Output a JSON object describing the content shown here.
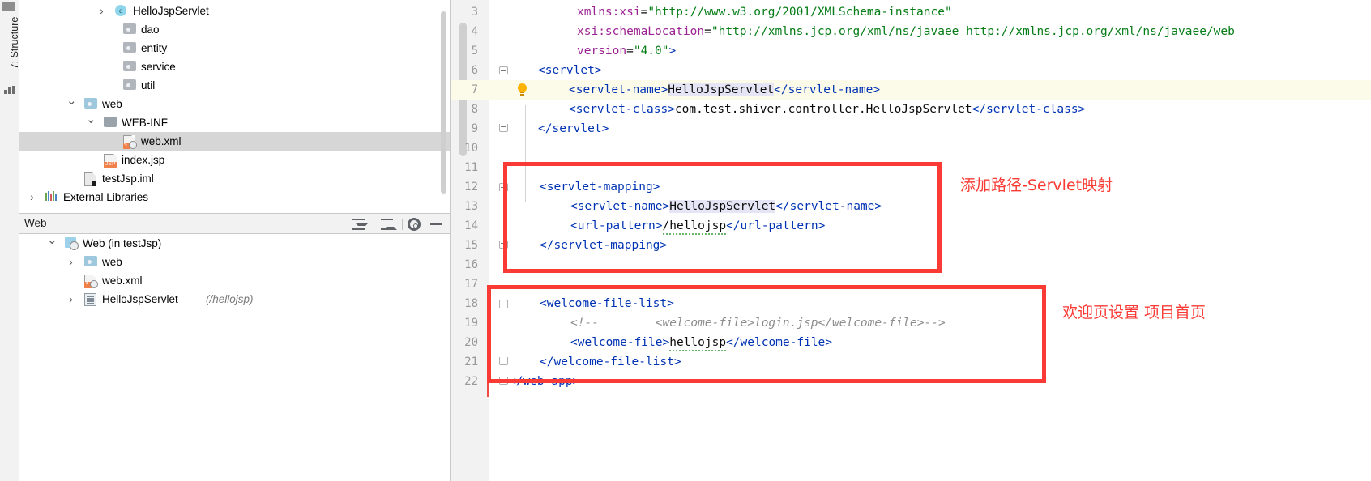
{
  "left_strip": {
    "label": "7: Structure",
    "square_icon": "panel-icon",
    "dots_icon": "structure-bars-icon"
  },
  "project_tree": {
    "items": [
      {
        "label": "HelloJspServlet",
        "icon": "class-icon",
        "arrow": "chevron-right",
        "indent": 118,
        "selected": false,
        "sub": ""
      },
      {
        "label": "dao",
        "icon": "folder-icon",
        "arrow": "",
        "indent": 128,
        "selected": false,
        "sub": ""
      },
      {
        "label": "entity",
        "icon": "folder-icon",
        "arrow": "",
        "indent": 128,
        "selected": false,
        "sub": ""
      },
      {
        "label": "service",
        "icon": "folder-icon",
        "arrow": "",
        "indent": 128,
        "selected": false,
        "sub": ""
      },
      {
        "label": "util",
        "icon": "folder-icon",
        "arrow": "",
        "indent": 128,
        "selected": false,
        "sub": ""
      },
      {
        "label": "web",
        "icon": "web-folder-icon",
        "arrow": "chevron-down",
        "indent": 80,
        "selected": false,
        "sub": ""
      },
      {
        "label": "WEB-INF",
        "icon": "folder-plain-icon",
        "arrow": "chevron-down",
        "indent": 104,
        "selected": false,
        "sub": ""
      },
      {
        "label": "web.xml",
        "icon": "xml-file-icon",
        "arrow": "",
        "indent": 128,
        "selected": true,
        "sub": ""
      },
      {
        "label": "index.jsp",
        "icon": "jsp-file-icon",
        "arrow": "",
        "indent": 104,
        "selected": false,
        "sub": ""
      },
      {
        "label": "testJsp.iml",
        "icon": "iml-file-icon",
        "arrow": "",
        "indent": 80,
        "selected": false,
        "sub": ""
      },
      {
        "label": "External Libraries",
        "icon": "libraries-icon",
        "arrow": "chevron-right",
        "indent": 32,
        "selected": false,
        "sub": ""
      }
    ]
  },
  "web_panel": {
    "title": "Web",
    "toolbar": [
      {
        "name": "expand-all-button",
        "icon": "expand-all-icon"
      },
      {
        "name": "collapse-all-button",
        "icon": "collapse-all-icon"
      },
      {
        "name": "settings-button",
        "icon": "gear-icon"
      },
      {
        "name": "hide-button",
        "icon": "minus-icon"
      }
    ],
    "items": [
      {
        "label": "Web (in testJsp)",
        "icon": "module-icon",
        "arrow": "chevron-down",
        "indent": 56,
        "sub": ""
      },
      {
        "label": "web",
        "icon": "web-folder-icon",
        "arrow": "chevron-right",
        "indent": 80,
        "sub": ""
      },
      {
        "label": "web.xml",
        "icon": "xml-file-icon",
        "arrow": "",
        "indent": 80,
        "sub": ""
      },
      {
        "label": "HelloJspServlet",
        "icon": "servlet-icon",
        "arrow": "chevron-right",
        "indent": 80,
        "sub": "(/hellojsp)"
      }
    ]
  },
  "editor": {
    "lines": [
      {
        "num": "3",
        "indent": 156,
        "html": "<span class='attr'>xmlns:xsi</span><span class='txtv'>=</span><span class='str'>\"http://www.w3.org/2001/XMLSchema-instance\"</span>",
        "highlight": false,
        "fold": "",
        "bulb": false
      },
      {
        "num": "4",
        "indent": 156,
        "html": "<span class='attr'>xsi:schemaLocation</span><span class='txtv'>=</span><span class='str'>\"http://xmlns.jcp.org/xml/ns/javaee http://xmlns.jcp.org/xml/ns/javaee/web</span>",
        "highlight": false,
        "fold": "",
        "bulb": false
      },
      {
        "num": "5",
        "indent": 156,
        "html": "<span class='attr'>version</span><span class='txtv'>=</span><span class='str'>\"4.0\"</span><span class='tag'>&gt;</span>",
        "highlight": false,
        "fold": "",
        "bulb": false
      },
      {
        "num": "6",
        "indent": 108,
        "html": "<span class='tag'>&lt;servlet&gt;</span>",
        "highlight": false,
        "fold": "top",
        "bulb": false
      },
      {
        "num": "7",
        "indent": 146,
        "html": "<span class='tag'>&lt;servlet-name&gt;</span><span class='txtv hlw'>HelloJspServlet</span><span class='tag'>&lt;/servlet-name&gt;</span>",
        "highlight": true,
        "fold": "",
        "bulb": true
      },
      {
        "num": "8",
        "indent": 146,
        "html": "<span class='tag'>&lt;servlet-class&gt;</span><span class='txtv'>com.test.shiver.controller.HelloJspServlet</span><span class='tag'>&lt;/servlet-class&gt;</span>",
        "highlight": false,
        "fold": "",
        "bulb": false
      },
      {
        "num": "9",
        "indent": 108,
        "html": "<span class='tag'>&lt;/servlet&gt;</span>",
        "highlight": false,
        "fold": "bot",
        "bulb": false
      },
      {
        "num": "10",
        "indent": 108,
        "html": "",
        "highlight": false,
        "fold": "",
        "bulb": false
      },
      {
        "num": "11",
        "indent": 108,
        "html": "",
        "highlight": false,
        "fold": "",
        "bulb": false
      },
      {
        "num": "12",
        "indent": 110,
        "html": "<span class='tag'>&lt;servlet-mapping&gt;</span>",
        "highlight": false,
        "fold": "top",
        "bulb": false
      },
      {
        "num": "13",
        "indent": 148,
        "html": "<span class='tag'>&lt;servlet-name&gt;</span><span class='txtv hlw'>HelloJspServlet</span><span class='tag'>&lt;/servlet-name&gt;</span>",
        "highlight": false,
        "fold": "",
        "bulb": false
      },
      {
        "num": "14",
        "indent": 148,
        "html": "<span class='tag'>&lt;url-pattern&gt;</span><span class='txtv squig'>/hellojsp</span><span class='tag'>&lt;/url-pattern&gt;</span>",
        "highlight": false,
        "fold": "",
        "bulb": false
      },
      {
        "num": "15",
        "indent": 110,
        "html": "<span class='tag'>&lt;/servlet-mapping&gt;</span>",
        "highlight": false,
        "fold": "bot",
        "bulb": false
      },
      {
        "num": "16",
        "indent": 110,
        "html": "",
        "highlight": false,
        "fold": "",
        "bulb": false
      },
      {
        "num": "17",
        "indent": 110,
        "html": "",
        "highlight": false,
        "fold": "",
        "bulb": false
      },
      {
        "num": "18",
        "indent": 110,
        "html": "<span class='tag'>&lt;welcome-file-list&gt;</span>",
        "highlight": false,
        "fold": "top",
        "bulb": false
      },
      {
        "num": "19",
        "indent": 148,
        "html": "<span class='comment'>&lt;!--        &lt;welcome-file&gt;login.jsp&lt;/welcome-file&gt;--&gt;</span>",
        "highlight": false,
        "fold": "",
        "bulb": false
      },
      {
        "num": "20",
        "indent": 148,
        "html": "<span class='tag'>&lt;welcome-file&gt;</span><span class='txtv squig'>hellojsp</span><span class='tag'>&lt;/welcome-file&gt;</span>",
        "highlight": false,
        "fold": "",
        "bulb": false
      },
      {
        "num": "21",
        "indent": 110,
        "html": "<span class='tag'>&lt;/welcome-file-list&gt;</span>",
        "highlight": false,
        "fold": "bot",
        "bulb": false
      },
      {
        "num": "22",
        "indent": 72,
        "html": "<span class='tag'>&lt;/web-app&gt;</span>",
        "highlight": false,
        "fold": "bot",
        "bulb": false
      }
    ]
  },
  "annotations": [
    {
      "name": "servlet-mapping-annotation",
      "text": "添加路径-Servlet映射",
      "color": "#fa3b35"
    },
    {
      "name": "welcome-page-annotation",
      "text": "欢迎页设置 项目首页",
      "color": "#fa3b35"
    }
  ]
}
